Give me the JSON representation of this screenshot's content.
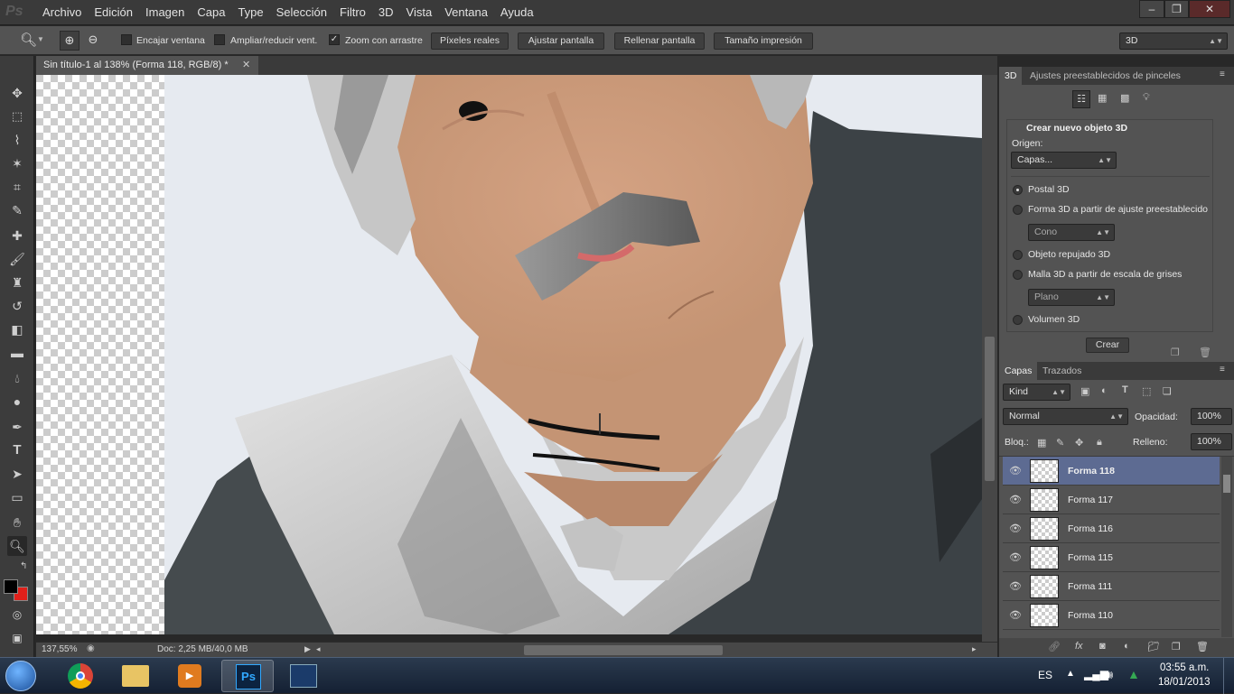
{
  "menubar": {
    "logo": "Ps",
    "items": [
      "Archivo",
      "Edición",
      "Imagen",
      "Capa",
      "Type",
      "Selección",
      "Filtro",
      "3D",
      "Vista",
      "Ventana",
      "Ayuda"
    ],
    "window_buttons": [
      "–",
      "❐",
      "✕"
    ]
  },
  "options": {
    "fit_window": "Encajar ventana",
    "resize_windows": "Ampliar/reducir vent.",
    "scrubby_zoom": "Zoom con arrastre",
    "actual_pixels": "Píxeles reales",
    "fit_screen": "Ajustar pantalla",
    "fill_screen": "Rellenar pantalla",
    "print_size": "Tamaño impresión",
    "workspace": "3D"
  },
  "document": {
    "tab_title": "Sin título-1 al 138% (Forma 118, RGB/8) *",
    "zoom": "137,55%",
    "doc_size": "Doc: 2,25 MB/40,0 MB"
  },
  "panel3d": {
    "tabs": [
      "3D",
      "Ajustes preestablecidos de pinceles"
    ],
    "section_title": "Crear nuevo objeto 3D",
    "origin_label": "Origen:",
    "origin_value": "Capas...",
    "options": [
      {
        "label": "Postal 3D",
        "selected": true
      },
      {
        "label": "Forma 3D a partir de ajuste preestablecido",
        "selected": false
      },
      {
        "label": "Objeto repujado 3D",
        "selected": false
      },
      {
        "label": "Malla 3D a partir de escala de grises",
        "selected": false
      },
      {
        "label": "Volumen 3D",
        "selected": false
      }
    ],
    "shape_preset": "Cono",
    "mesh_preset": "Plano",
    "create_button": "Crear"
  },
  "layers": {
    "tabs": [
      "Capas",
      "Trazados"
    ],
    "filter_kind": "Kind",
    "blend_mode": "Normal",
    "opacity_label": "Opacidad:",
    "opacity_value": "100%",
    "lock_label": "Bloq.:",
    "fill_label": "Relleno:",
    "fill_value": "100%",
    "rows": [
      "Forma 118",
      "Forma 117",
      "Forma 116",
      "Forma 115",
      "Forma 111",
      "Forma 110"
    ],
    "selected_index": 0
  },
  "taskbar": {
    "language": "ES",
    "time": "03:55 a.m.",
    "date": "18/01/2013"
  },
  "colors": {
    "foreground": "#000000",
    "background": "#e0201a",
    "selected_layer": "#5d6b92"
  }
}
